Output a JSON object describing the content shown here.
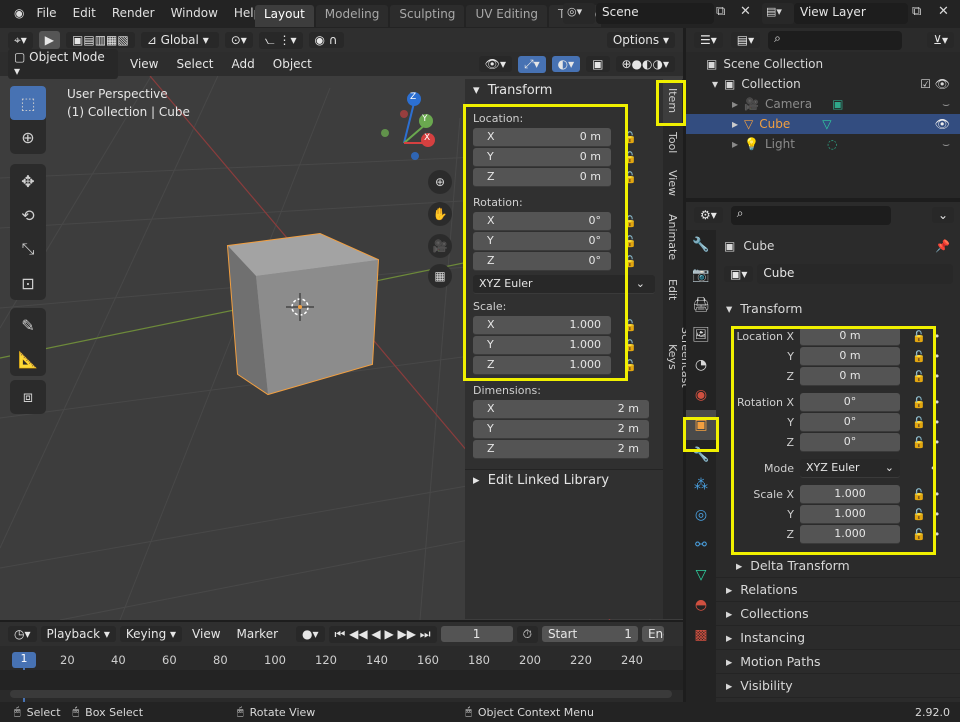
{
  "topbar": {
    "menus": [
      "File",
      "Edit",
      "Render",
      "Window",
      "Help"
    ],
    "workspaces": [
      "Layout",
      "Modeling",
      "Sculpting",
      "UV Editing",
      "Texture"
    ],
    "active_workspace": "Layout",
    "scene": "Scene",
    "view_layer": "View Layer"
  },
  "viewport": {
    "transform_orientation": "Global",
    "options_label": "Options",
    "mode": "Object Mode",
    "menus": [
      "View",
      "Select",
      "Add",
      "Object"
    ],
    "perspective_label": "User Perspective",
    "collection_label": "(1) Collection | Cube",
    "axes": {
      "z": "Z",
      "y": "Y",
      "x": "X"
    }
  },
  "npanel": {
    "transform_title": "Transform",
    "location_label": "Location:",
    "location": [
      {
        "axis": "X",
        "value": "0 m"
      },
      {
        "axis": "Y",
        "value": "0 m"
      },
      {
        "axis": "Z",
        "value": "0 m"
      }
    ],
    "rotation_label": "Rotation:",
    "rotation": [
      {
        "axis": "X",
        "value": "0°"
      },
      {
        "axis": "Y",
        "value": "0°"
      },
      {
        "axis": "Z",
        "value": "0°"
      }
    ],
    "rotation_mode": "XYZ Euler",
    "scale_label": "Scale:",
    "scale": [
      {
        "axis": "X",
        "value": "1.000"
      },
      {
        "axis": "Y",
        "value": "1.000"
      },
      {
        "axis": "Z",
        "value": "1.000"
      }
    ],
    "dimensions_label": "Dimensions:",
    "dimensions": [
      {
        "axis": "X",
        "value": "2 m"
      },
      {
        "axis": "Y",
        "value": "2 m"
      },
      {
        "axis": "Z",
        "value": "2 m"
      }
    ],
    "linked_library": "Edit Linked Library",
    "tabs": [
      "Item",
      "Tool",
      "View",
      "Animate",
      "Edit",
      "Screencast Keys"
    ]
  },
  "timeline": {
    "menus": [
      "Playback",
      "Keying",
      "View",
      "Marker"
    ],
    "current_frame": "1",
    "start_label": "Start",
    "start_value": "1",
    "end_label": "End",
    "frame_badge": "1",
    "ticks": [
      "20",
      "40",
      "60",
      "80",
      "100",
      "120",
      "140",
      "160",
      "180",
      "200",
      "220",
      "240"
    ]
  },
  "statusbar": {
    "select": "Select",
    "box_select": "Box Select",
    "rotate_view": "Rotate View",
    "context_menu": "Object Context Menu",
    "version": "2.92.0"
  },
  "outliner": {
    "scene_collection": "Scene Collection",
    "collection": "Collection",
    "items": [
      "Camera",
      "Cube",
      "Light"
    ],
    "selected": "Cube"
  },
  "properties": {
    "object_name": "Cube",
    "data_name": "Cube",
    "transform_title": "Transform",
    "location_x_label": "Location X",
    "rotation_x_label": "Rotation X",
    "mode_label": "Mode",
    "scale_x_label": "Scale X",
    "y_label": "Y",
    "z_label": "Z",
    "location": [
      "0 m",
      "0 m",
      "0 m"
    ],
    "rotation": [
      "0°",
      "0°",
      "0°"
    ],
    "mode": "XYZ Euler",
    "scale": [
      "1.000",
      "1.000",
      "1.000"
    ],
    "sections": [
      "Delta Transform",
      "Relations",
      "Collections",
      "Instancing",
      "Motion Paths",
      "Visibility"
    ]
  },
  "colors": {
    "highlight": "#f0f000",
    "selection": "#4772b3",
    "orange": "#f29f40"
  }
}
